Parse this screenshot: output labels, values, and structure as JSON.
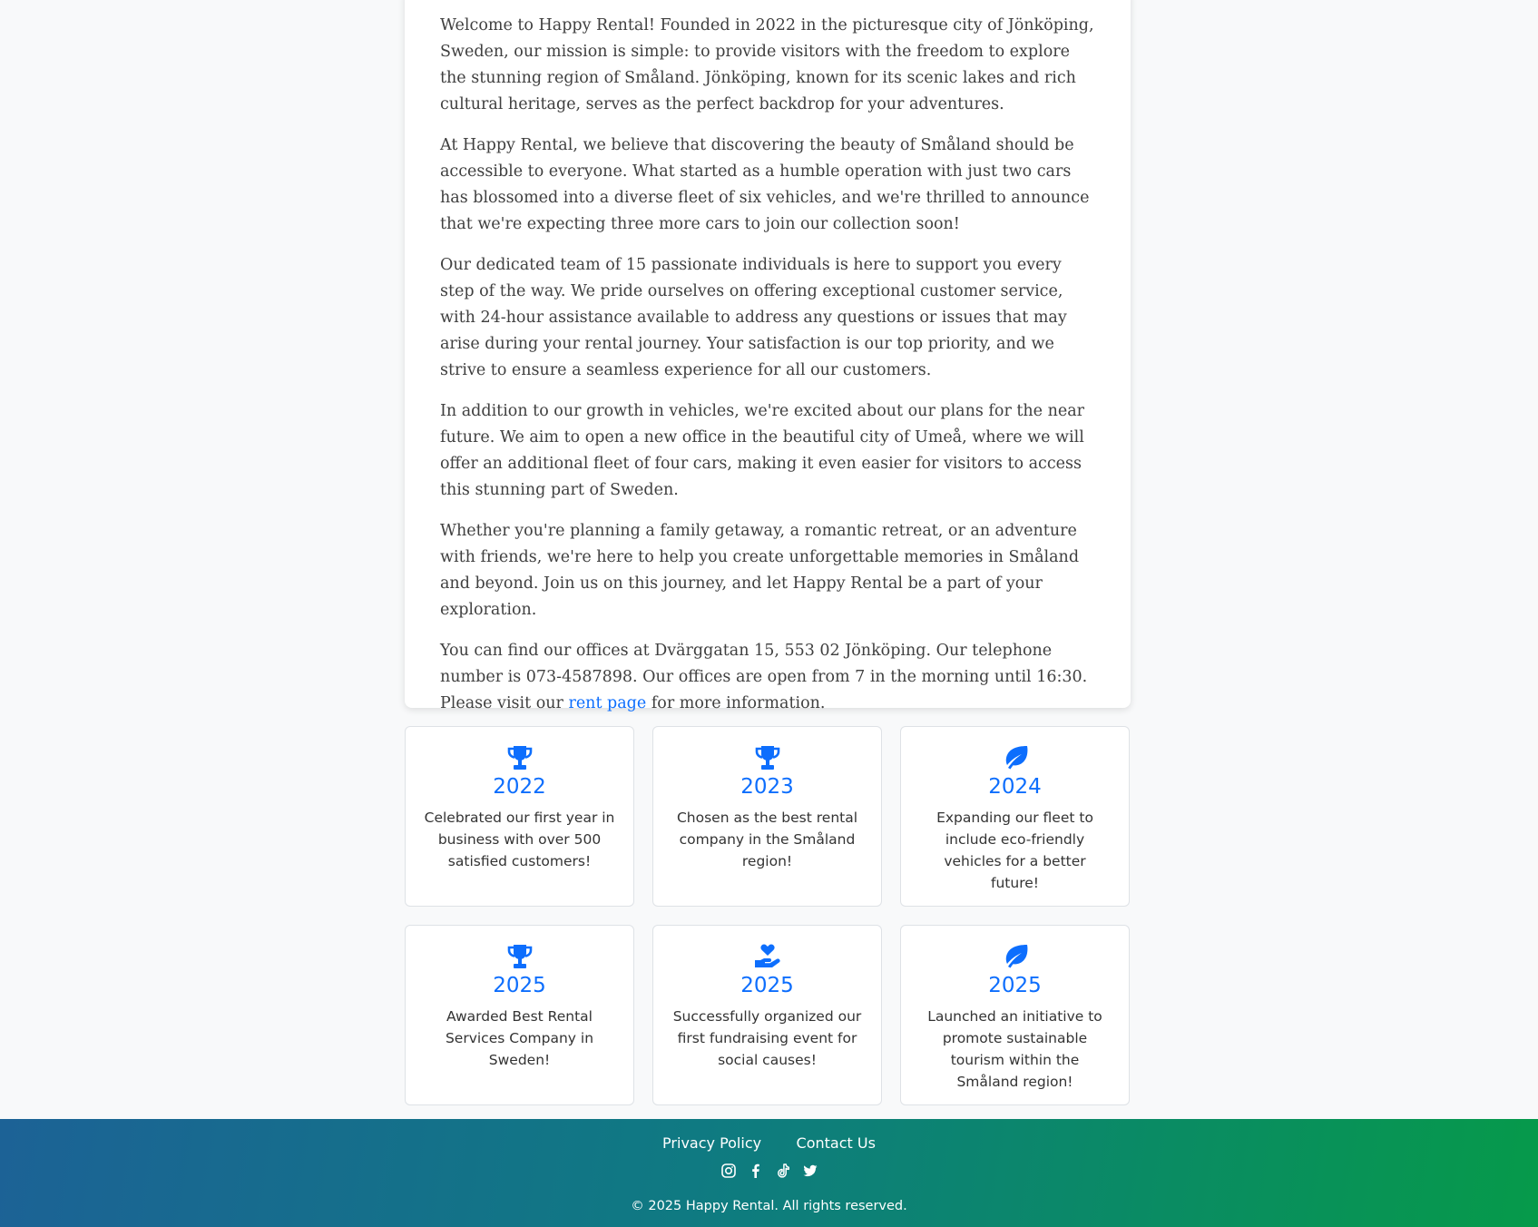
{
  "about": {
    "p1": "Welcome to Happy Rental! Founded in 2022 in the picturesque city of Jönköping, Sweden, our mission is simple: to provide visitors with the freedom to explore the stunning region of Småland. Jönköping, known for its scenic lakes and rich cultural heritage, serves as the perfect backdrop for your adventures.",
    "p2": "At Happy Rental, we believe that discovering the beauty of Småland should be accessible to everyone. What started as a humble operation with just two cars has blossomed into a diverse fleet of six vehicles, and we're thrilled to announce that we're expecting three more cars to join our collection soon!",
    "p3": "Our dedicated team of 15 passionate individuals is here to support you every step of the way. We pride ourselves on offering exceptional customer service, with 24-hour assistance available to address any questions or issues that may arise during your rental journey. Your satisfaction is our top priority, and we strive to ensure a seamless experience for all our customers.",
    "p4": "In addition to our growth in vehicles, we're excited about our plans for the near future. We aim to open a new office in the beautiful city of Umeå, where we will offer an additional fleet of four cars, making it even easier for visitors to access this stunning part of Sweden.",
    "p5": "Whether you're planning a family getaway, a romantic retreat, or an adventure with friends, we're here to help you create unforgettable memories in Småland and beyond. Join us on this journey, and let Happy Rental be a part of your exploration.",
    "p6_before": "You can find our offices at Dvärggatan 15, 553 02 Jönköping. Our telephone number is 073-4587898. Our offices are open from 7 in the morning until 16:30. Please visit our ",
    "p6_link": "rent page",
    "p6_after": " for more information."
  },
  "accent_color": "#0d6efd",
  "milestones": [
    {
      "icon": "trophy-icon",
      "year": "2022",
      "text": "Celebrated our first year in business with over 500 satisfied customers!"
    },
    {
      "icon": "trophy-icon",
      "year": "2023",
      "text": "Chosen as the best rental company in the Småland region!"
    },
    {
      "icon": "leaf-icon",
      "year": "2024",
      "text": "Expanding our fleet to include eco-friendly vehicles for a better future!"
    },
    {
      "icon": "trophy-icon",
      "year": "2025",
      "text": "Awarded Best Rental Services Company in Sweden!"
    },
    {
      "icon": "hand-holding-heart-icon",
      "year": "2025",
      "text": "Successfully organized our first fundraising event for social causes!"
    },
    {
      "icon": "leaf-icon",
      "year": "2025",
      "text": "Launched an initiative to promote sustainable tourism within the Småland region!"
    }
  ],
  "footer": {
    "privacy": "Privacy Policy",
    "contact": "Contact Us",
    "socials": [
      "instagram-icon",
      "facebook-icon",
      "tiktok-icon",
      "twitter-icon"
    ],
    "copyright": "© 2025 Happy Rental. All rights reserved."
  }
}
